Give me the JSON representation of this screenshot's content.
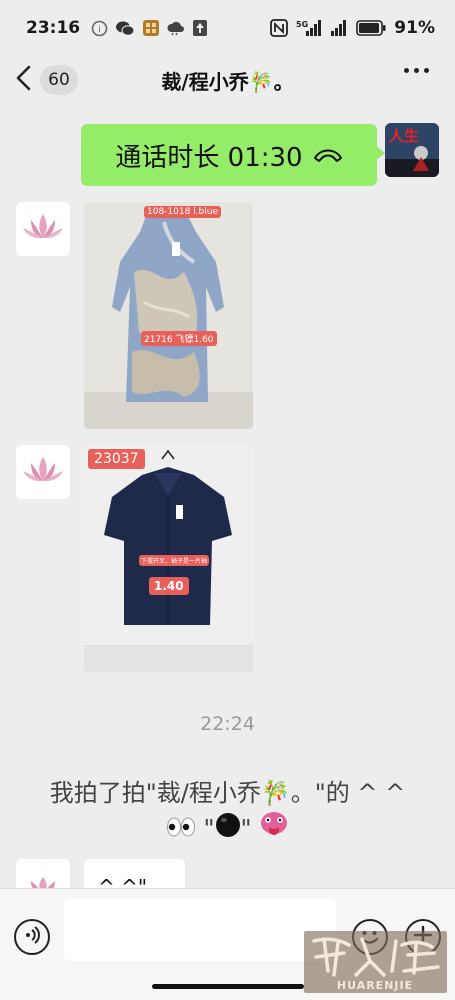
{
  "status_bar": {
    "time": "23:16",
    "battery_percent": "91%",
    "network_label": "5G",
    "icons": [
      "sync-icon",
      "wechat-icon",
      "app-icon",
      "cloud-icon",
      "upload-icon",
      "nfc-icon",
      "signal-icon",
      "wifi-signal-icon",
      "battery-icon"
    ]
  },
  "header": {
    "unread_count": "60",
    "title": "裁/程小乔🎋。"
  },
  "messages": {
    "call": {
      "text": "通话时长 01:30"
    },
    "photo_1": {
      "tag_top": "108-1018 l.blue",
      "tag_mid": "21716 飞镖1.60"
    },
    "photo_2": {
      "tag_top": "23037",
      "tag_note": "下摆开叉，袖子是一片袖",
      "tag_price": "1.40"
    },
    "time_divider": "22:24",
    "system_line1": "我拍了拍\"裁/程小乔🎋。\"的 ^ ^",
    "system_line2": "\"",
    "system_line2b": "\"",
    "partial_text": "^ ^\"..."
  },
  "input_bar": {
    "placeholder": ""
  },
  "watermark": {
    "text": "华人街",
    "subtext": "HUARENJIE"
  },
  "colors": {
    "background": "#ededed",
    "bubble_self": "#95ec69",
    "bubble_other": "#ffffff",
    "tag_red": "#e8605a",
    "dress_blue": "#8da6c8",
    "shirt_navy": "#1f2a4a"
  }
}
